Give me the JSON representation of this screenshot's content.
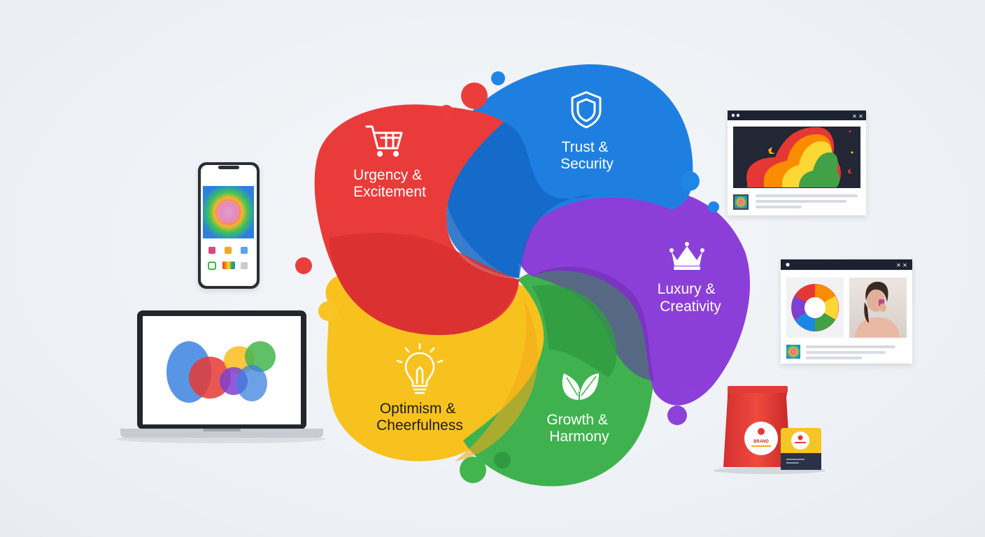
{
  "segments": [
    {
      "id": "urgency",
      "lines": [
        "Urgency &",
        "Excitement"
      ],
      "color": "#ea3b3b",
      "icon": "shopping-cart-icon"
    },
    {
      "id": "trust",
      "lines": [
        "Trust &",
        "Security"
      ],
      "color": "#1f7fe0",
      "icon": "shield-icon"
    },
    {
      "id": "luxury",
      "lines": [
        "Luxury &",
        "Creativity"
      ],
      "color": "#8b3fd8",
      "icon": "crown-icon"
    },
    {
      "id": "growth",
      "lines": [
        "Growth &",
        "Harmony"
      ],
      "color": "#3fb24f",
      "icon": "leaf-icon"
    },
    {
      "id": "optimism",
      "lines": [
        "Optimism &",
        "Cheerfulness"
      ],
      "color": "#f8c21e",
      "icon": "lightbulb-icon"
    }
  ],
  "devices": {
    "phone": {
      "icon": "smartphone-icon"
    },
    "laptop": {
      "icon": "laptop-icon"
    },
    "browser_top": {
      "icon": "browser-window-icon",
      "controls": "✕ ✕"
    },
    "browser_bottom": {
      "icon": "browser-window-icon",
      "controls": "✕ ✕"
    },
    "packaging": {
      "icon": "coffee-bag-icon",
      "label_text": "BRAND"
    }
  }
}
